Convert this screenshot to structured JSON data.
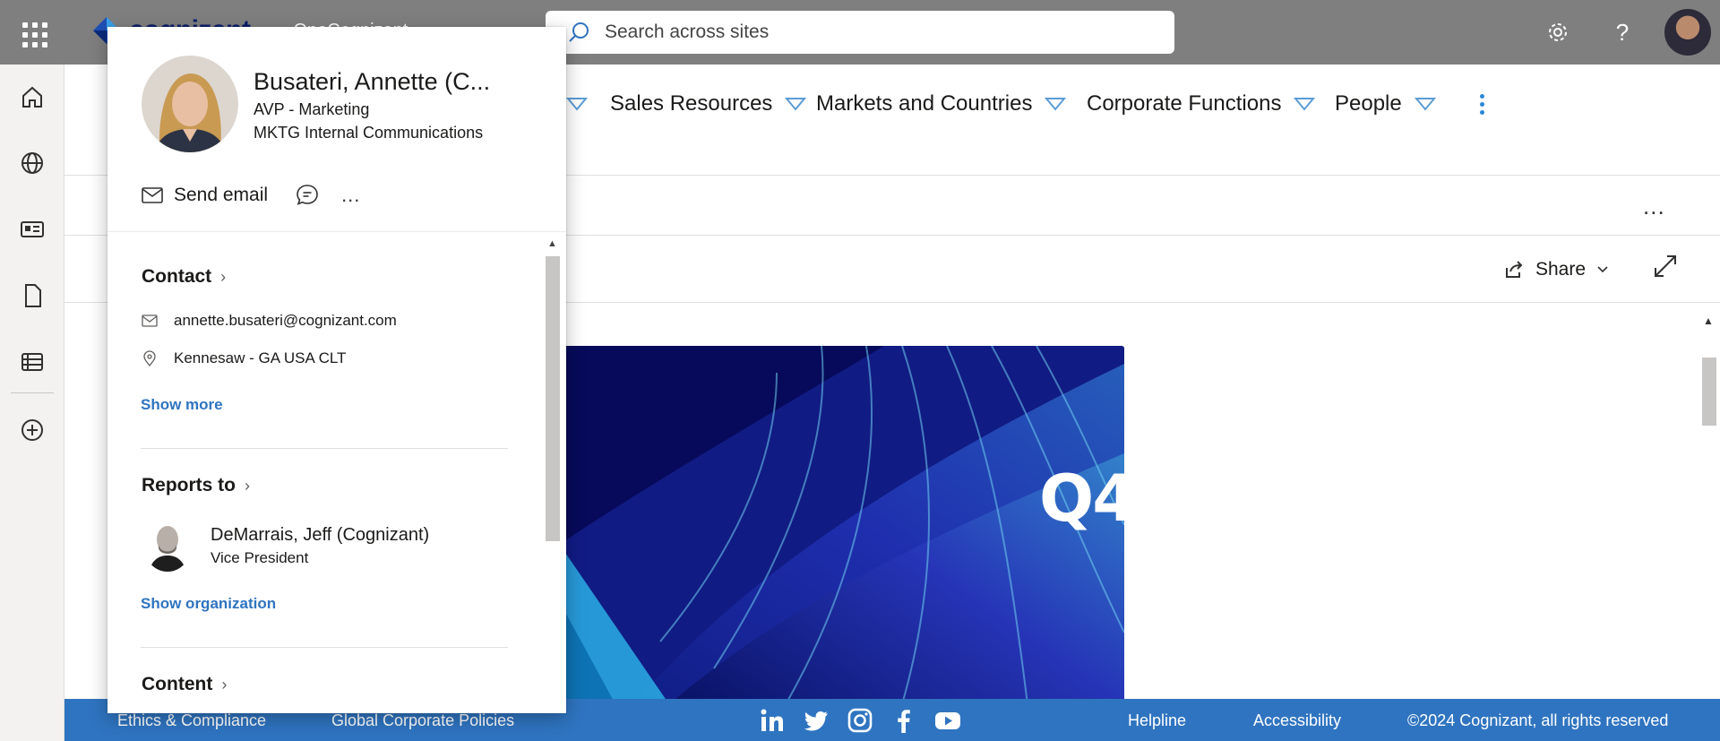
{
  "suitebar": {
    "brand": "cognizant",
    "site_name": "OneCognizant",
    "search_placeholder": "Search across sites",
    "settings_icon": "gear-icon",
    "help_icon": "question-icon",
    "help_glyph": "?"
  },
  "appbar": {
    "items": [
      "home-icon",
      "globe-icon",
      "news-icon",
      "file-icon",
      "list-icon",
      "add-icon"
    ]
  },
  "hubnav": {
    "items": [
      {
        "label": "Sales Resources"
      },
      {
        "label": "Markets and Countries"
      },
      {
        "label": "Corporate Functions"
      },
      {
        "label": "People"
      }
    ]
  },
  "cmdbar": {
    "more_label": "..."
  },
  "sharebar": {
    "share_label": "Share"
  },
  "hero": {
    "overlay_text": "Q4"
  },
  "profile_card": {
    "name": "Busateri, Annette (C...",
    "title": "AVP - Marketing",
    "department": "MKTG Internal Communications",
    "send_email_label": "Send email",
    "more_label": "...",
    "contact_heading": "Contact",
    "email": "annette.busateri@cognizant.com",
    "location": "Kennesaw - GA USA CLT",
    "show_more_label": "Show more",
    "reports_to_heading": "Reports to",
    "manager_name": "DeMarrais, Jeff (Cognizant)",
    "manager_title": "Vice President",
    "show_org_label": "Show organization",
    "content_heading": "Content"
  },
  "footer": {
    "links": [
      "Ethics & Compliance",
      "Global Corporate Policies"
    ],
    "social": [
      "linkedin-icon",
      "twitter-icon",
      "instagram-icon",
      "facebook-icon",
      "youtube-icon"
    ],
    "helpline": "Helpline",
    "accessibility": "Accessibility",
    "copyright": "©2024 Cognizant, all rights reserved"
  },
  "colors": {
    "suitebar": "#7f7f7f",
    "footer": "#2f74c0",
    "link": "#2f74c0",
    "nav_triangle": "#5b9bd5"
  }
}
